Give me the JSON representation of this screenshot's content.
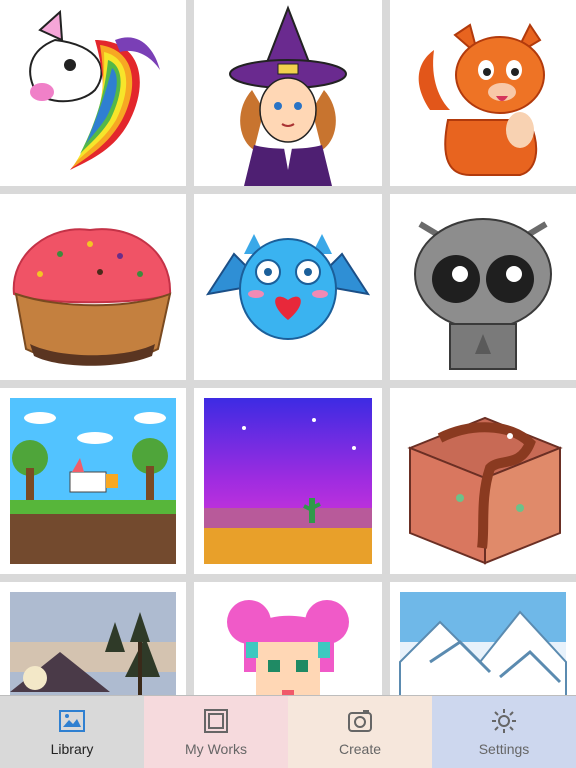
{
  "library": {
    "tiles": [
      {
        "name": "unicorn"
      },
      {
        "name": "witch"
      },
      {
        "name": "cat"
      },
      {
        "name": "cupcake"
      },
      {
        "name": "bat"
      },
      {
        "name": "alien"
      },
      {
        "name": "unicorn-landscape"
      },
      {
        "name": "desert-night"
      },
      {
        "name": "cake-slice"
      },
      {
        "name": "forest-sunset"
      },
      {
        "name": "pink-hair-girl"
      },
      {
        "name": "snowy-mountains"
      }
    ]
  },
  "tabbar": {
    "tabs": [
      {
        "label": "Library",
        "icon": "picture-icon",
        "color": "#d9d9d9",
        "active": true
      },
      {
        "label": "My Works",
        "icon": "frame-icon",
        "color": "#f6dadd",
        "active": false
      },
      {
        "label": "Create",
        "icon": "camera-icon",
        "color": "#f6e7dc",
        "active": false
      },
      {
        "label": "Settings",
        "icon": "gear-icon",
        "color": "#cdd7ee",
        "active": false
      }
    ]
  }
}
